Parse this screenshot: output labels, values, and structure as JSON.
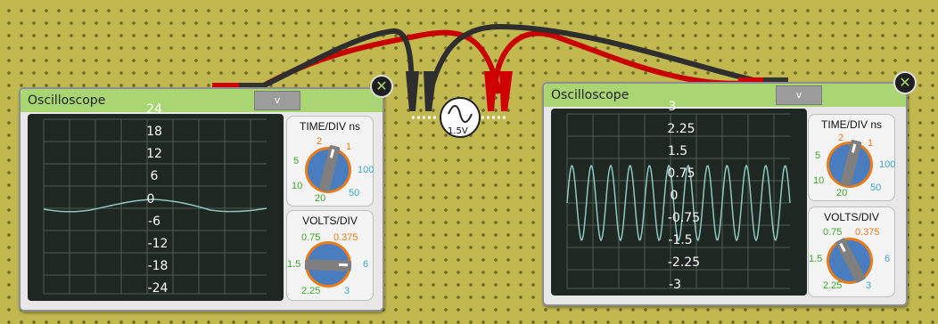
{
  "scopes": [
    {
      "title": "Oscilloscope",
      "close_label": "✕",
      "dropdown_label": "v",
      "y_ticks": [
        "24",
        "18",
        "12",
        "6",
        "0",
        "-6",
        "-12",
        "-18",
        "-24"
      ],
      "time_div": {
        "title": "TIME/DIV ns",
        "labels": [
          "2",
          "1",
          "5",
          "100",
          "10",
          "50",
          "20"
        ]
      },
      "volts_div": {
        "title": "VOLTS/DIV",
        "labels": [
          "0.75",
          "0.375",
          "1.5",
          "6",
          "2.25",
          "3"
        ]
      }
    },
    {
      "title": "Oscilloscope",
      "close_label": "✕",
      "dropdown_label": "v",
      "y_ticks": [
        "3",
        "2.25",
        "1.5",
        "0.75",
        "0",
        "-0.75",
        "-1.5",
        "-2.25",
        "-3"
      ],
      "time_div": {
        "title": "TIME/DIV ns",
        "labels": [
          "2",
          "1",
          "5",
          "100",
          "10",
          "50",
          "20"
        ]
      },
      "volts_div": {
        "title": "VOLTS/DIV",
        "labels": [
          "0.75",
          "0.375",
          "1.5",
          "6",
          "2.25",
          "3"
        ]
      }
    }
  ],
  "source": {
    "label": "1.5V",
    "icon": "ac-source-icon"
  },
  "colors": {
    "board": "#c2b850",
    "screen": "#1e2722",
    "trace": "#8fc6c0",
    "header": "#a9d672",
    "red_wire": "#e00000",
    "black_wire": "#3a3a3a",
    "knob_blue": "#4a7cc0"
  }
}
